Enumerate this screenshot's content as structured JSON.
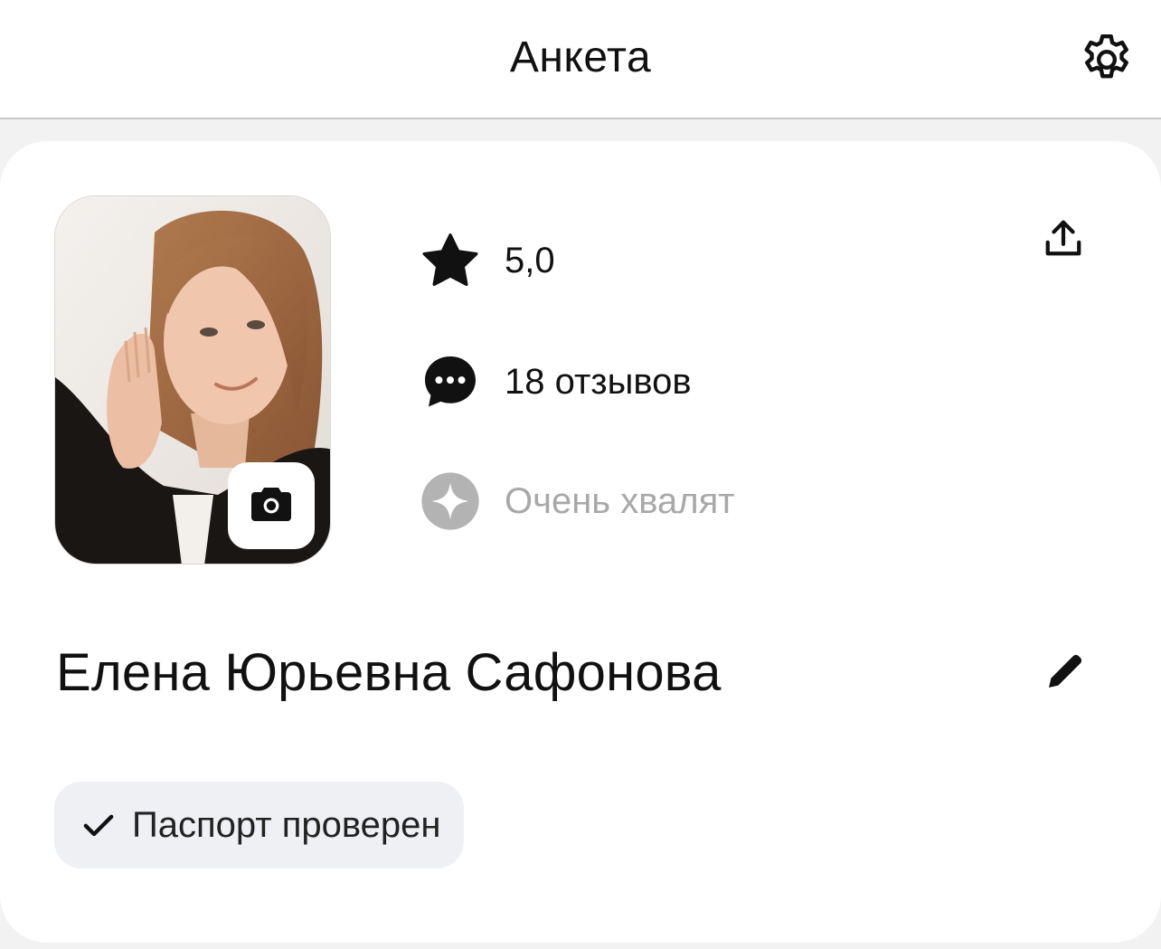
{
  "header": {
    "title": "Анкета",
    "settings_icon": "gear-icon"
  },
  "profile": {
    "photo_icon": "camera-icon",
    "rating": {
      "icon": "star-icon",
      "value": "5,0"
    },
    "reviews": {
      "icon": "chat-bubble-icon",
      "label": "18 отзывов"
    },
    "praise": {
      "icon": "sparkle-icon",
      "label": "Очень хвалят",
      "enabled": false
    },
    "share_icon": "share-icon",
    "name": "Елена Юрьевна Сафонова",
    "edit_icon": "pencil-icon",
    "verification": {
      "icon": "check-icon",
      "label": "Паспорт проверен"
    }
  },
  "colors": {
    "background": "#f2f2f2",
    "card": "#ffffff",
    "text": "#111111",
    "muted": "#a8a8a8",
    "badge_bg": "#eef0f3"
  }
}
